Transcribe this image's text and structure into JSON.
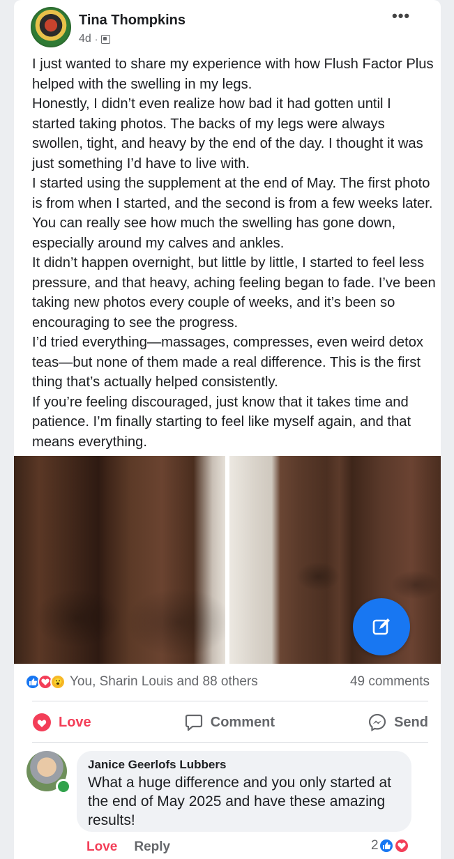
{
  "post": {
    "author": "Tina Thompkins",
    "time": "4d",
    "separator": "·",
    "paragraphs": [
      "I just wanted to share my experience with how Flush Factor Plus helped with the swelling in my legs.",
      "Honestly, I didn’t even realize how bad it had gotten until I started taking photos. The backs of my legs were always swollen, tight, and heavy by the end of the day. I thought it was just something I’d have to live with.",
      "I started using the supplement at the end of May. The first photo is from when I started, and the second is from a few weeks later. You can really see how much the swelling has gone down, especially around my calves and ankles.",
      "It didn’t happen overnight, but little by little, I started to feel less pressure, and that heavy, aching feeling began to fade. I’ve been taking new photos every couple of weeks, and it’s been so encouraging to see the progress.",
      "I’d tried everything—massages, compresses, even weird detox teas—but none of them made a real difference. This is the first thing that’s actually helped consistently.",
      "If you’re feeling discouraged, just know that it takes time and patience. I’m finally starting to feel like myself again, and that means everything."
    ],
    "more_icon": "•••"
  },
  "reactions": {
    "summary": "You, Sharin Louis and 88 others",
    "comments": "49 comments",
    "wow_glyph": "😮"
  },
  "actions": {
    "love": "Love",
    "comment": "Comment",
    "send": "Send"
  },
  "comment": {
    "author": "Janice Geerlofs Lubbers",
    "text": "What a huge difference and you only started at the end of May 2025  and have these amazing results!",
    "love": "Love",
    "reply": "Reply",
    "reaction_count": "2"
  },
  "colors": {
    "accent": "#1877f2",
    "love": "#f33e58",
    "online": "#31a24c"
  }
}
